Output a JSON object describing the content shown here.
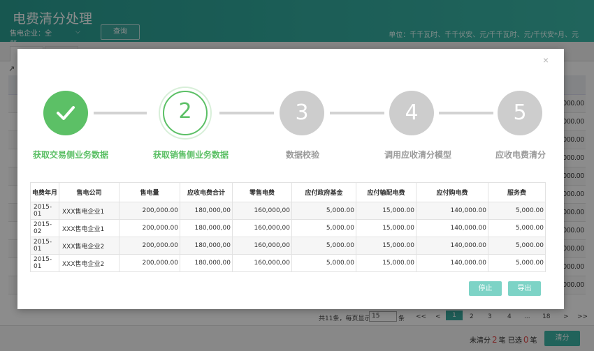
{
  "background": {
    "title": "电费清分处理",
    "company_label": "售电企业：全部",
    "query_button": "查询",
    "unit_note": "单位：千千瓦时、千千伏安、元/千千瓦时、元/千伏安*月、元",
    "visible_amounts": [
      "0,000.00",
      "0,000.00",
      "0,000.00",
      "0,000.00",
      "0,000.00",
      "0,000.00",
      "0,000.00",
      "0,000.00",
      "0,000.00",
      "0,000.00",
      "0,000.00"
    ],
    "pager": {
      "summary": "共11条，每页显示",
      "page_size": "15",
      "unit": "条",
      "first": "<<",
      "prev": "<",
      "pages": [
        "1",
        "2",
        "3",
        "4",
        "...",
        "18"
      ],
      "next": ">",
      "last": ">>"
    },
    "footer": {
      "uncleared_prefix": "未清分",
      "uncleared_count": "2",
      "unit1": "笔",
      "selected_prefix": "已选",
      "selected_count": "0",
      "unit2": "笔",
      "clear_button": "清分"
    }
  },
  "modal": {
    "close": "×",
    "steps": [
      {
        "label": "获取交易侧业务数据",
        "number": "",
        "status": "done"
      },
      {
        "label": "获取销售侧业务数据",
        "number": "2",
        "status": "active"
      },
      {
        "label": "数据校验",
        "number": "3",
        "status": "pending"
      },
      {
        "label": "调用应收清分模型",
        "number": "4",
        "status": "pending"
      },
      {
        "label": "应收电费清分",
        "number": "5",
        "status": "pending"
      }
    ],
    "table": {
      "headers": [
        "电费年月",
        "售电公司",
        "售电量",
        "应收电费合计",
        "零售电费",
        "应付政府基金",
        "应付输配电费",
        "应付购电费",
        "服务费"
      ],
      "rows": [
        [
          "2015-01",
          "XXX售电企业1",
          "200,000.00",
          "180,000,00",
          "160,000,00",
          "5,000.00",
          "15,000.00",
          "140,000.00",
          "5,000.00"
        ],
        [
          "2015-02",
          "XXX售电企业1",
          "200,000.00",
          "180,000,00",
          "160,000,00",
          "5,000.00",
          "15,000.00",
          "140,000.00",
          "5,000.00"
        ],
        [
          "2015-01",
          "XXX售电企业2",
          "200,000.00",
          "180,000,00",
          "160,000,00",
          "5,000.00",
          "15,000.00",
          "140,000.00",
          "5,000.00"
        ],
        [
          "2015-01",
          "XXX售电企业2",
          "200,000.00",
          "180,000,00",
          "160,000,00",
          "5,000.00",
          "15,000.00",
          "140,000.00",
          "5,000.00"
        ]
      ]
    },
    "stop_button": "停止",
    "export_button": "导出"
  },
  "colors": {
    "accent": "#3bb7a8",
    "step_done": "#5cc066",
    "step_pending": "#cdcdcd",
    "modal_button": "#7dd3c6",
    "count_red": "#e14a4a"
  },
  "icons": {
    "step_done": "check-icon",
    "close": "close-icon",
    "edit": "edit-icon",
    "dropdown": "chevron-down-icon"
  }
}
